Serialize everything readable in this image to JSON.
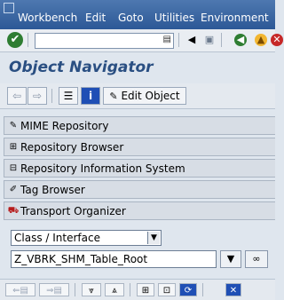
{
  "menu": {
    "items": [
      "Workbench",
      "Edit",
      "Goto",
      "Utilities",
      "Environment"
    ]
  },
  "toolbar": {
    "command_value": "",
    "icons": [
      "enter-icon",
      "back-icon",
      "save-icon",
      "back-nav-icon",
      "exit-icon",
      "cancel-icon"
    ]
  },
  "title": "Object Navigator",
  "app_toolbar": {
    "edit_object_label": "Edit Object",
    "icons": [
      "back-arrow-icon",
      "forward-arrow-icon",
      "hierarchy-icon",
      "info-icon",
      "edit-object-icon"
    ]
  },
  "panels": [
    {
      "label": "MIME Repository",
      "icon": "mime-icon"
    },
    {
      "label": "Repository Browser",
      "icon": "repository-browser-icon"
    },
    {
      "label": "Repository Information System",
      "icon": "repository-info-icon"
    },
    {
      "label": "Tag Browser",
      "icon": "tag-browser-icon"
    },
    {
      "label": "Transport Organizer",
      "icon": "transport-organizer-icon"
    }
  ],
  "object_selector": {
    "type_value": "Class / Interface",
    "name_value": "Z_VBRK_SHM_Table_Root"
  },
  "bottom_toolbar": {
    "icons": [
      "previous-object-icon",
      "next-object-icon",
      "collapse-icon",
      "expand-icon",
      "tree-icon",
      "tree-select-icon",
      "refresh-icon",
      "close-icon"
    ]
  },
  "colors": {
    "title_bar": "#2c5896",
    "title_text": "#2a4f82",
    "background": "#dfe6ee"
  }
}
